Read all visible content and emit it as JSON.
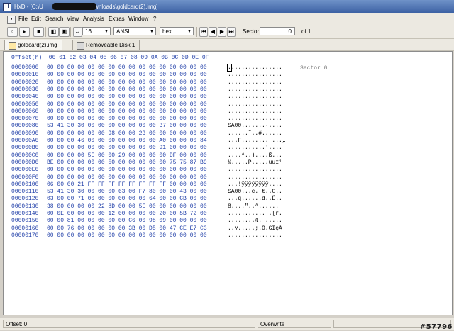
{
  "window": {
    "title_prefix": "HxD - [C:\\U",
    "title_suffix": "Downloads\\goldcard(2).img]",
    "app_icon": "hxd-icon"
  },
  "menu": [
    "File",
    "Edit",
    "Search",
    "View",
    "Analysis",
    "Extras",
    "Window",
    "?"
  ],
  "toolbar": {
    "bytes_per_row": "16",
    "charset": "ANSI",
    "mode": "hex",
    "sector_label": "Sector",
    "sector_value": "0",
    "sector_total": "of 1"
  },
  "tabs": [
    {
      "label": "goldcard(2).img",
      "active": true
    },
    {
      "label": "Removeable Disk 1",
      "active": false
    }
  ],
  "hex_view": {
    "header": "Offset(h)  00 01 02 03 04 05 06 07 08 09 0A 0B 0C 0D 0E 0F",
    "sector_marker": "Sector 0",
    "rows": [
      {
        "offset": "00000000",
        "hex": "00 00 00 00 00 00 00 00 00 00 00 00 00 00 00 00",
        "text": "................"
      },
      {
        "offset": "00000010",
        "hex": "00 00 00 00 00 00 00 00 00 00 00 00 00 00 00 00",
        "text": "................"
      },
      {
        "offset": "00000020",
        "hex": "00 00 00 00 00 00 00 00 00 00 00 00 00 00 00 00",
        "text": "................"
      },
      {
        "offset": "00000030",
        "hex": "00 00 00 00 00 00 00 00 00 00 00 00 00 00 00 00",
        "text": "................"
      },
      {
        "offset": "00000040",
        "hex": "00 00 00 00 00 00 00 00 00 00 00 00 00 00 00 00",
        "text": "................"
      },
      {
        "offset": "00000050",
        "hex": "00 00 00 00 00 00 00 00 00 00 00 00 00 00 00 00",
        "text": "................"
      },
      {
        "offset": "00000060",
        "hex": "00 00 00 00 00 00 00 00 00 00 00 00 00 00 00 00",
        "text": "................"
      },
      {
        "offset": "00000070",
        "hex": "00 00 00 00 00 00 00 00 00 00 00 00 00 00 00 00",
        "text": "................"
      },
      {
        "offset": "00000080",
        "hex": "53 41 30 30 00 00 00 00 00 00 00 B7 00 00 00 00",
        "text": "SA00.......·...."
      },
      {
        "offset": "00000090",
        "hex": "00 00 00 00 00 00 98 00 00 23 00 00 00 00 00 00",
        "text": "......˜..#......"
      },
      {
        "offset": "000000A0",
        "hex": "00 00 00 46 00 00 00 00 00 00 00 A0 00 00 00 84",
        "text": "...F........ ...„"
      },
      {
        "offset": "000000B0",
        "hex": "00 00 00 00 00 00 00 00 00 00 00 91 00 00 00 00",
        "text": "...........'...."
      },
      {
        "offset": "000000C0",
        "hex": "00 00 00 00 5E 00 00 29 00 00 00 00 DF 00 00 00",
        "text": "....^..)....ß..."
      },
      {
        "offset": "000000D0",
        "hex": "BE 00 00 00 00 00 50 00 00 00 00 00 75 75 87 B9",
        "text": "¾.....P.....uu‡¹"
      },
      {
        "offset": "000000E0",
        "hex": "00 00 00 00 00 00 00 00 00 00 00 00 00 00 00 00",
        "text": "................"
      },
      {
        "offset": "000000F0",
        "hex": "00 00 00 00 00 00 00 00 00 00 00 00 00 00 00 00",
        "text": "................"
      },
      {
        "offset": "00000100",
        "hex": "06 00 00 21 FF FF FF FF FF FF FF FF 00 00 00 00",
        "text": "...!ÿÿÿÿÿÿÿÿ...."
      },
      {
        "offset": "00000110",
        "hex": "53 41 30 30 00 00 00 63 00 F7 80 00 00 43 00 00",
        "text": "SA00...c.÷€..C.."
      },
      {
        "offset": "00000120",
        "hex": "03 00 00 71 00 00 00 00 00 00 64 00 00 CB 00 00",
        "text": "...q......d..Ë.."
      },
      {
        "offset": "00000130",
        "hex": "38 00 00 00 00 22 8D 00 00 5E 00 00 00 00 00 00",
        "text": "8....\"..^......"
      },
      {
        "offset": "00000140",
        "hex": "00 0E 00 00 00 00 12 00 00 00 00 20 00 5B 72 00",
        "text": "........... .[r."
      },
      {
        "offset": "00000150",
        "hex": "00 00 81 00 00 00 00 00 C6 00 98 09 00 00 00 00",
        "text": "........Æ.˜....."
      },
      {
        "offset": "00000160",
        "hex": "00 00 76 00 00 00 00 00 3B 00 D5 00 47 CE E7 C3",
        "text": "..v.....;.Õ.GÎçÃ"
      },
      {
        "offset": "00000170",
        "hex": "00 00 00 00 00 00 00 00 00 00 00 00 00 00 00 00",
        "text": "................"
      }
    ]
  },
  "status": {
    "offset": "Offset: 0",
    "mode": "Overwrite"
  },
  "watermark": "#57796"
}
